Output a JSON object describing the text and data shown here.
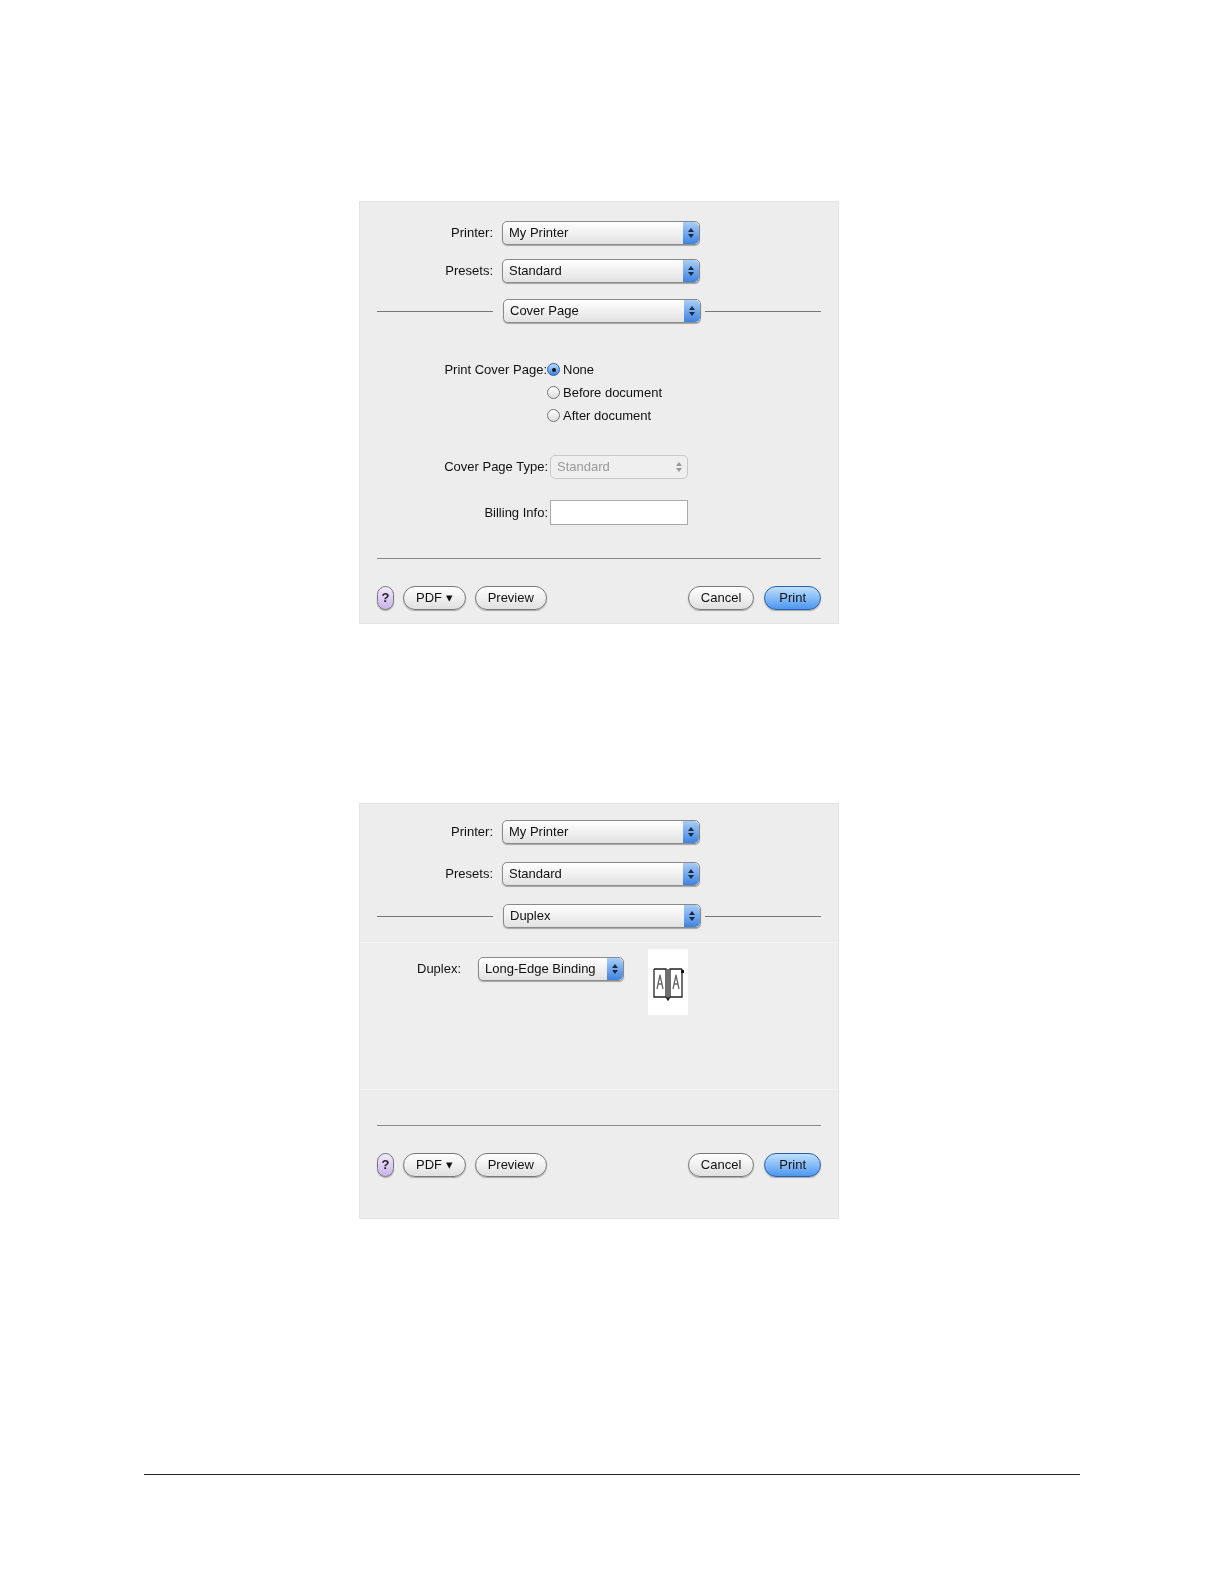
{
  "dialogs": [
    {
      "kind": "cover_page",
      "popups": [
        {
          "label": "Printer:",
          "value": "My Printer"
        },
        {
          "label": "Presets:",
          "value": "Standard"
        }
      ],
      "pane": "Cover Page",
      "print_cover_page": {
        "label": "Print Cover Page:",
        "options": [
          {
            "label": "None",
            "selected": true
          },
          {
            "label": "Before document",
            "selected": false
          },
          {
            "label": "After document",
            "selected": false
          }
        ]
      },
      "cover_page_type": {
        "label": "Cover Page Type:",
        "value": "Standard",
        "disabled": true
      },
      "billing_info": {
        "label": "Billing Info:"
      },
      "buttons": [
        {
          "label": "?",
          "kind": "help"
        },
        {
          "label": "PDF ▾",
          "kind": "normal"
        },
        {
          "label": "Preview",
          "kind": "normal"
        },
        {
          "label": "Cancel",
          "kind": "normal"
        },
        {
          "label": "Print",
          "kind": "default"
        }
      ]
    },
    {
      "kind": "duplex",
      "popups": [
        {
          "label": "Printer:",
          "value": "My Printer"
        },
        {
          "label": "Presets:",
          "value": "Standard"
        }
      ],
      "pane": "Duplex",
      "duplex": {
        "label": "Duplex:",
        "value": "Long-Edge Binding"
      },
      "buttons": [
        {
          "label": "?",
          "kind": "help"
        },
        {
          "label": "PDF ▾",
          "kind": "normal"
        },
        {
          "label": "Preview",
          "kind": "normal"
        },
        {
          "label": "Cancel",
          "kind": "normal"
        },
        {
          "label": "Print",
          "kind": "default"
        }
      ]
    }
  ]
}
